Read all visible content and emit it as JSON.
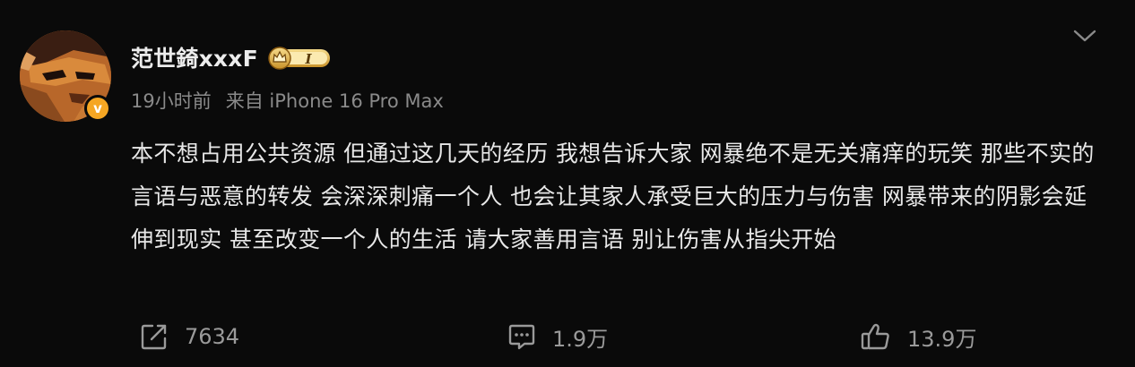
{
  "post": {
    "username": "范世錡xxxF",
    "member_level": "I",
    "verified_mark": "v",
    "time": "19小时前",
    "source": "来自 iPhone 16 Pro Max",
    "content": "本不想占用公共资源 但通过这几天的经历 我想告诉大家 网暴绝不是无关痛痒的玩笑 那些不实的言语与恶意的转发 会深深刺痛一个人 也会让其家人承受巨大的压力与伤害 网暴带来的阴影会延伸到现实 甚至改变一个人的生活 请大家善用言语 别让伤害从指尖开始"
  },
  "actions": {
    "repost_count": "7634",
    "comment_count": "1.9万",
    "like_count": "13.9万"
  },
  "icons": {
    "more": "chevron-down-icon",
    "repost": "share-icon",
    "comment": "comment-icon",
    "like": "thumbs-up-icon"
  },
  "colors": {
    "background": "#0a0a0a",
    "text": "#e8e8e8",
    "meta": "#8a8a8a",
    "verified": "#f5a623",
    "badge_gold": "#d9a93a"
  }
}
